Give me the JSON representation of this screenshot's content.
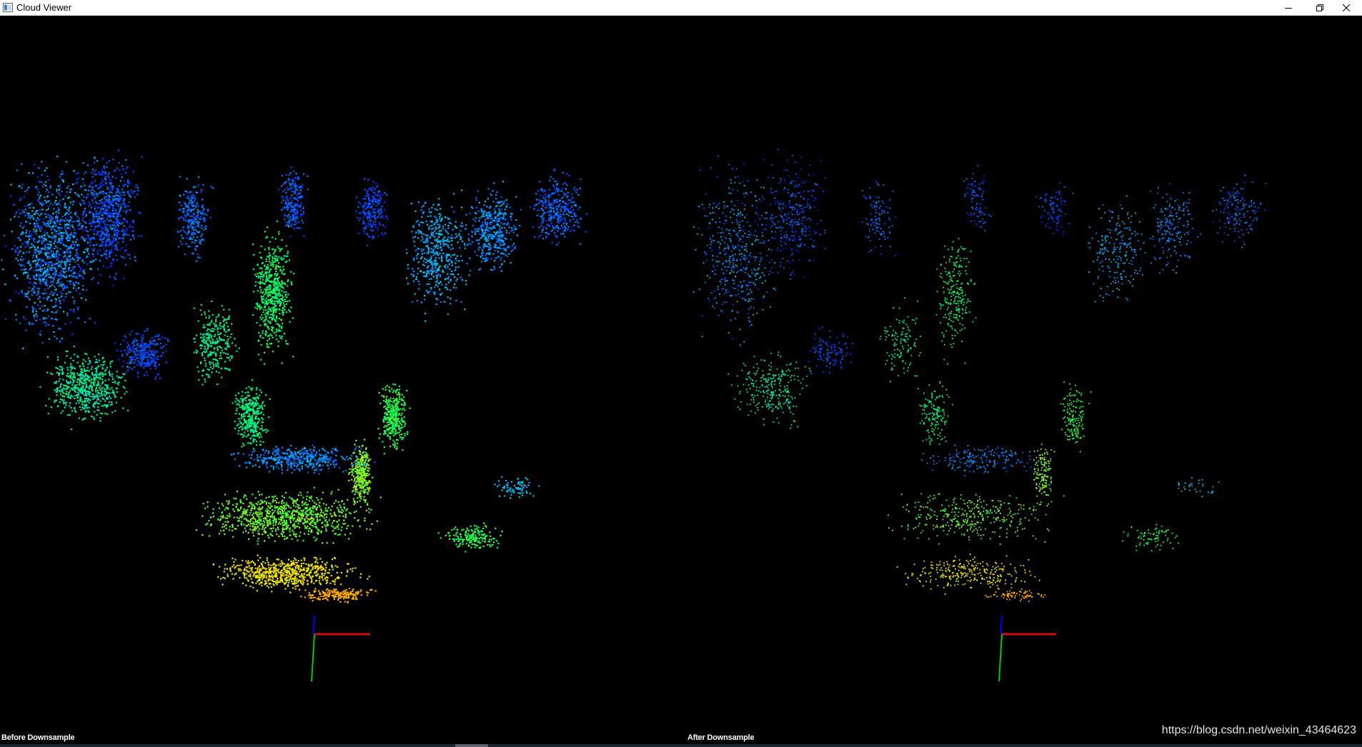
{
  "window": {
    "title": "Cloud Viewer",
    "app_icon": "window-app-icon",
    "controls": {
      "minimize_icon": "minimize-icon",
      "restore_icon": "restore-icon",
      "close_icon": "close-icon"
    }
  },
  "viewports": [
    {
      "label": "Before Downsample",
      "density": "dense"
    },
    {
      "label": "After Downsample",
      "density": "sparse"
    }
  ],
  "colors": {
    "background": "#000000",
    "axis_x": "#ff0000",
    "axis_y": "#00cc00",
    "axis_z": "#0000ff",
    "colormap": [
      "#0000ff",
      "#00c8ff",
      "#00ff50",
      "#ffe600",
      "#ff8c00"
    ]
  },
  "watermark": "https://blog.csdn.net/weixin_43464623"
}
